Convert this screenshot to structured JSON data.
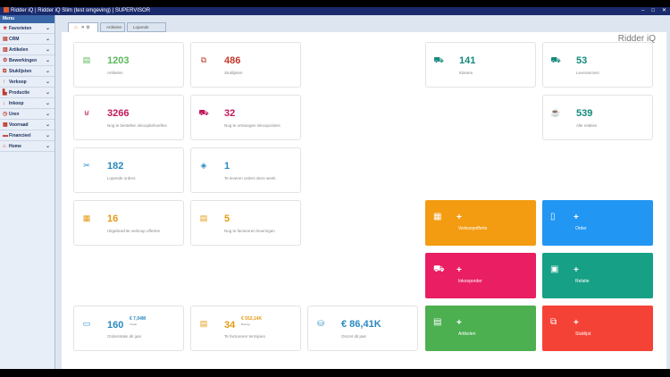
{
  "window": {
    "title": "Ridder iQ | Ridder iQ Slim (test omgeving) | SUPERVISOR"
  },
  "sidebar": {
    "header": "Menu",
    "items": [
      {
        "label": "Favorieten",
        "icon": "star-icon"
      },
      {
        "label": "CRM",
        "icon": "crm-icon"
      },
      {
        "label": "Artikelen",
        "icon": "articles-icon"
      },
      {
        "label": "Bewerkingen",
        "icon": "operations-icon"
      },
      {
        "label": "Stuklijsten",
        "icon": "bom-icon"
      },
      {
        "label": "Verkoop",
        "icon": "sales-icon"
      },
      {
        "label": "Productie",
        "icon": "production-icon"
      },
      {
        "label": "Inkoop",
        "icon": "purchase-icon"
      },
      {
        "label": "Uren",
        "icon": "hours-icon"
      },
      {
        "label": "Voorraad",
        "icon": "stock-icon"
      },
      {
        "label": "Financieel",
        "icon": "finance-icon"
      },
      {
        "label": "Home",
        "icon": "home-icon"
      }
    ]
  },
  "tabs": {
    "home_extra": "✕  ⚙",
    "artikelen": "Artikelen",
    "orders": "Lopende orders"
  },
  "brand": "Ridder iQ",
  "cards": {
    "artikelen": {
      "value": "1203",
      "label": "Artikelen"
    },
    "stuklijsten": {
      "value": "486",
      "label": "Stuklijsten"
    },
    "klanten": {
      "value": "141",
      "label": "Klanten"
    },
    "leveranciers": {
      "value": "53",
      "label": "Leveranciers"
    },
    "inkoopbehoeftes": {
      "value": "3266",
      "label": "Nog te bestellen inkoopbehoeftes"
    },
    "inkooporders": {
      "value": "32",
      "label": "Nog te ontvangen inkooporders"
    },
    "relaties": {
      "value": "539",
      "label": "Alle relaties"
    },
    "lopende": {
      "value": "182",
      "label": "Lopende orders"
    },
    "leveren": {
      "value": "1",
      "label": "Te leveren orders deze week"
    },
    "offertes": {
      "value": "16",
      "label": "Uitgebrachte verkoop offertes"
    },
    "factureren": {
      "value": "5",
      "label": "Nog te factureren leveringen"
    },
    "orderintake": {
      "value": "160",
      "label": "Orderintake dit jaar",
      "sub": "€ 7,04M",
      "sub2": "Totaal"
    },
    "termijnen": {
      "value": "34",
      "label": "Te factureren termijnen",
      "sub": "€ 552,14K",
      "sub2": "Bedrag"
    },
    "omzet": {
      "value": "€ 86,41K",
      "label": "Omzet dit jaar"
    }
  },
  "actions": {
    "plus": "+",
    "verkoopofferte": {
      "label": "Verkoopofferte",
      "color": "#f39c12"
    },
    "order": {
      "label": "Order",
      "color": "#2196f3"
    },
    "inkooporder": {
      "label": "Inkooporder",
      "color": "#e91e63"
    },
    "relatie": {
      "label": "Relatie",
      "color": "#16a085"
    },
    "artikelen": {
      "label": "Artikelen",
      "color": "#4caf50"
    },
    "stuklijst": {
      "label": "Stuklijst",
      "color": "#f44336"
    }
  }
}
